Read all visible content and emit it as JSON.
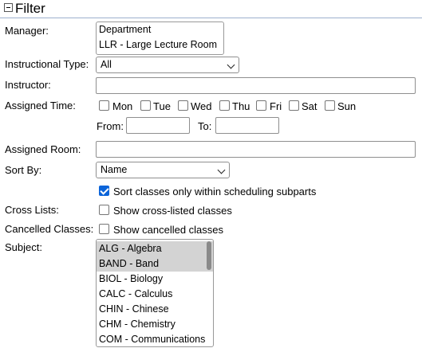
{
  "header": {
    "title": "Filter"
  },
  "labels": {
    "manager": "Manager:",
    "instructional_type": "Instructional Type:",
    "instructor": "Instructor:",
    "assigned_time": "Assigned Time:",
    "assigned_room": "Assigned Room:",
    "sort_by": "Sort By:",
    "cross_lists": "Cross Lists:",
    "cancelled_classes": "Cancelled Classes:",
    "subject": "Subject:",
    "from": "From:",
    "to": "To:"
  },
  "manager_options": [
    "Department",
    "LLR - Large Lecture Room"
  ],
  "instructional_type": {
    "value": "All"
  },
  "instructor": {
    "value": ""
  },
  "days": [
    "Mon",
    "Tue",
    "Wed",
    "Thu",
    "Fri",
    "Sat",
    "Sun"
  ],
  "time": {
    "from": "",
    "to": ""
  },
  "assigned_room": {
    "value": ""
  },
  "sort_by": {
    "value": "Name"
  },
  "checkboxes": {
    "sort_within_subparts": {
      "label": "Sort classes only within scheduling subparts",
      "checked": true
    },
    "show_cross_listed": {
      "label": "Show cross-listed classes",
      "checked": false
    },
    "show_cancelled": {
      "label": "Show cancelled classes",
      "checked": false
    }
  },
  "subject_options": [
    {
      "label": "ALG - Algebra",
      "selected": true
    },
    {
      "label": "BAND - Band",
      "selected": true
    },
    {
      "label": "BIOL - Biology",
      "selected": false
    },
    {
      "label": "CALC - Calculus",
      "selected": false
    },
    {
      "label": "CHIN - Chinese",
      "selected": false
    },
    {
      "label": "CHM - Chemistry",
      "selected": false
    },
    {
      "label": "COM - Communications",
      "selected": false
    }
  ],
  "colors": {
    "accent": "#0b64d9",
    "selected_option": "#d3d3d3",
    "header_rule": "#9cb0ce"
  }
}
